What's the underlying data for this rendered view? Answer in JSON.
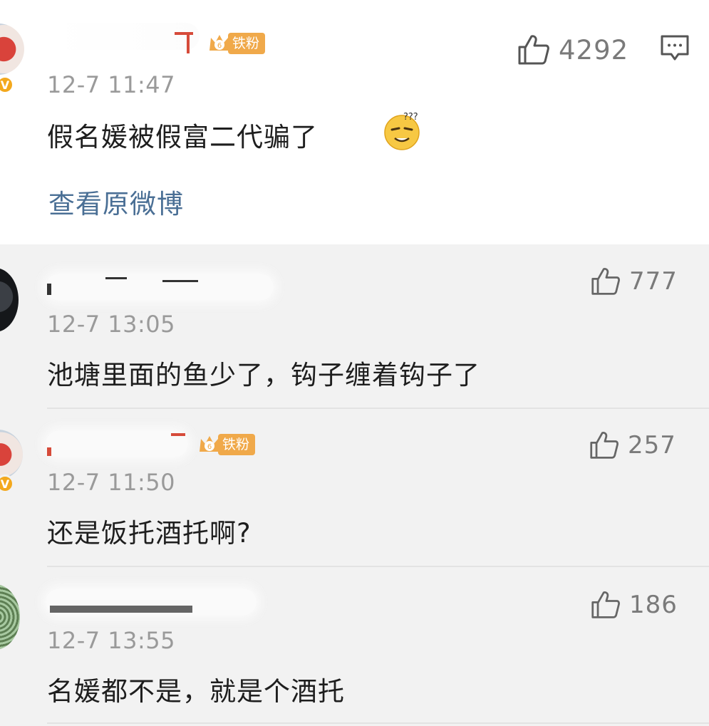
{
  "main": {
    "fan_badge": {
      "level": "6",
      "label": "铁粉"
    },
    "time": "12-7 11:47",
    "text": "假名媛被假富二代骗了",
    "emoji": "dizzy-face-emoji",
    "like_count": "4292",
    "view_original": "查看原微博"
  },
  "replies": [
    {
      "time": "12-7 13:05",
      "text": "池塘里面的鱼少了，钩子缠着钩子了",
      "like_count": "777"
    },
    {
      "fan_badge": {
        "level": "6",
        "label": "铁粉"
      },
      "time": "12-7 11:50",
      "text": "还是饭托酒托啊?",
      "like_count": "257"
    },
    {
      "time": "12-7 13:55",
      "text": "名媛都不是，就是个酒托",
      "like_count": "186"
    }
  ],
  "colors": {
    "link": "#4a6f95",
    "badge": "#f0a94a",
    "verified": "#f3a81d",
    "reply_bg": "#f2f2f2"
  }
}
